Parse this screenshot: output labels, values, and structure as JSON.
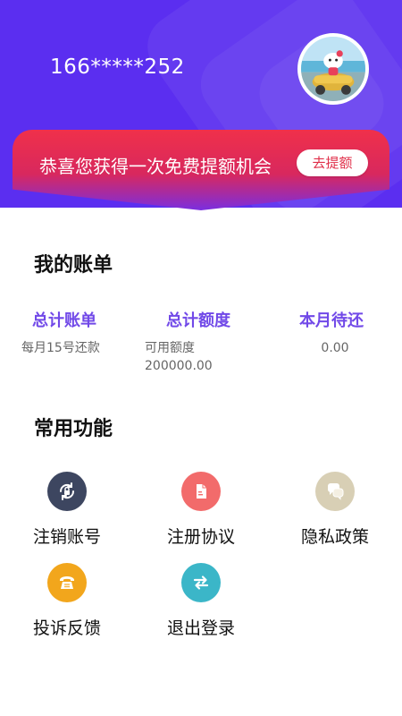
{
  "header": {
    "phone": "166*****252"
  },
  "banner": {
    "text": "恭喜您获得一次免费提额机会",
    "button_label": "去提额"
  },
  "bill": {
    "section_title": "我的账单",
    "columns": [
      {
        "title": "总计账单",
        "sub": "每月15号还款",
        "value": ""
      },
      {
        "title": "总计额度",
        "sub": "可用额度",
        "value": "200000.00"
      },
      {
        "title": "本月待还",
        "sub": "0.00",
        "value": ""
      }
    ]
  },
  "functions": {
    "section_title": "常用功能",
    "items": [
      {
        "label": "注销账号",
        "icon": "account-cancel-icon",
        "color": "#3d4660"
      },
      {
        "label": "注册协议",
        "icon": "document-icon",
        "color": "#f26b6b"
      },
      {
        "label": "隐私政策",
        "icon": "privacy-chat-icon",
        "color": "#d8cfb5"
      },
      {
        "label": "投诉反馈",
        "icon": "phone-icon",
        "color": "#f2a61c"
      },
      {
        "label": "退出登录",
        "icon": "swap-arrows-icon",
        "color": "#3bb6c8"
      }
    ]
  },
  "colors": {
    "header_bg": "#5b2ef0",
    "accent_purple": "#7149e8",
    "banner_red": "#f0304a"
  }
}
